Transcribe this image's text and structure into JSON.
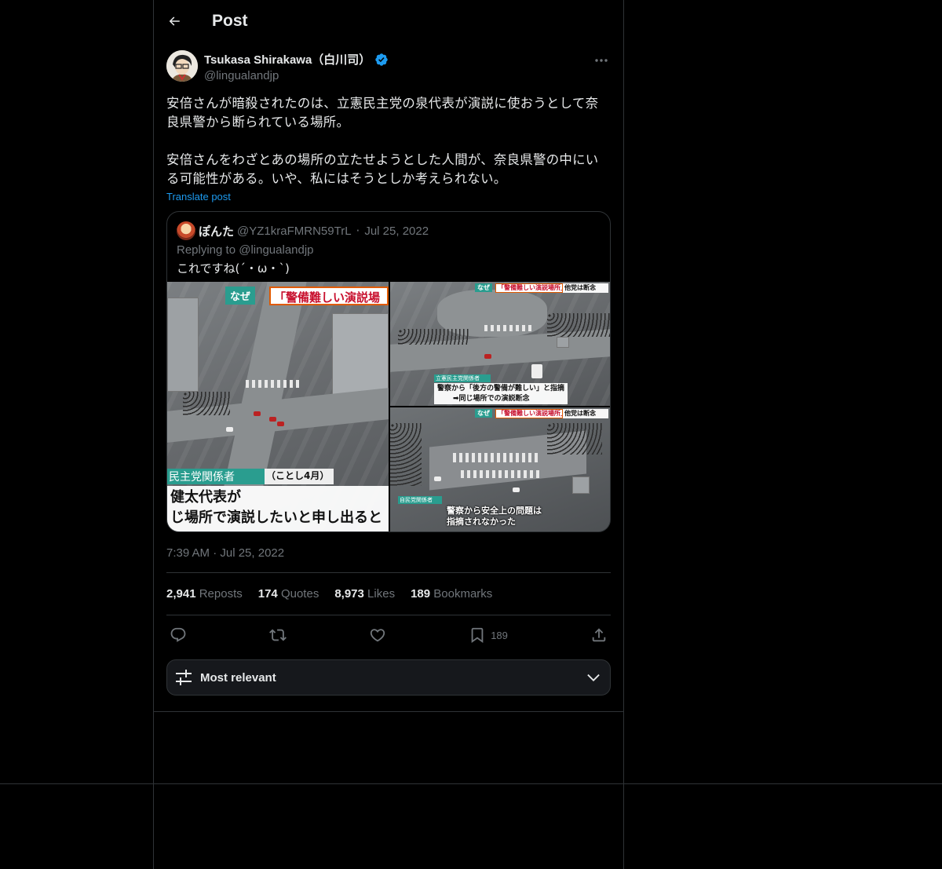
{
  "header": {
    "title": "Post"
  },
  "author": {
    "name": "Tsukasa Shirakawa（白川司）",
    "handle": "@lingualandjp"
  },
  "tweet": {
    "text": "安倍さんが暗殺されたのは、立憲民主党の泉代表が演説に使おうとして奈良県警から断られている場所。\n\n安倍さんをわざとあの場所の立たせようとした人間が、奈良県警の中にいる可能性がある。いや、私にはそうとしか考えられない。",
    "translate_label": "Translate post",
    "timestamp": "7:39 AM · Jul 25, 2022"
  },
  "quote": {
    "name": "ぽんた",
    "handle": "@YZ1kraFMRN59TrL",
    "dot": "·",
    "date": "Jul 25, 2022",
    "replying_prefix": "Replying to",
    "replying_handle": "@lingualandjp",
    "text": "これですね(´・ω・`)",
    "images": {
      "left": {
        "naze": "なぜ",
        "banner": "「警備難しい演説場",
        "label": "民主党関係者",
        "label_sub": "（ことし4月）",
        "line1": "健太代表が",
        "line2": "じ場所で演説したいと申し出ると"
      },
      "top_right": {
        "naze": "なぜ",
        "banner": "「警備難しい演説場所」",
        "banner_tail": "他党は断念",
        "small": "立憲民主党関係者",
        "line1": "警察から「後方の警備が難しい」と指摘",
        "line2": "➡同じ場所での演説断念"
      },
      "bottom_right": {
        "naze": "なぜ",
        "banner": "「警備難しい演説場所」",
        "banner_tail": "他党は断念",
        "small": "自民党関係者",
        "line1": "警察から安全上の問題は",
        "line2": "指摘されなかった"
      }
    }
  },
  "stats": [
    {
      "count": "2,941",
      "label": "Reposts"
    },
    {
      "count": "174",
      "label": "Quotes"
    },
    {
      "count": "8,973",
      "label": "Likes"
    },
    {
      "count": "189",
      "label": "Bookmarks"
    }
  ],
  "actions": {
    "reply_icon": "reply-icon",
    "repost_icon": "repost-icon",
    "like_icon": "heart-icon",
    "bookmark_icon": "bookmark-icon",
    "bookmark_count": "189",
    "share_icon": "share-icon"
  },
  "sort": {
    "label": "Most relevant"
  },
  "colors": {
    "background": "#000000",
    "border": "#2f3336",
    "muted": "#71767b",
    "accent": "#1d9bf0",
    "text": "#e7e9ea"
  }
}
